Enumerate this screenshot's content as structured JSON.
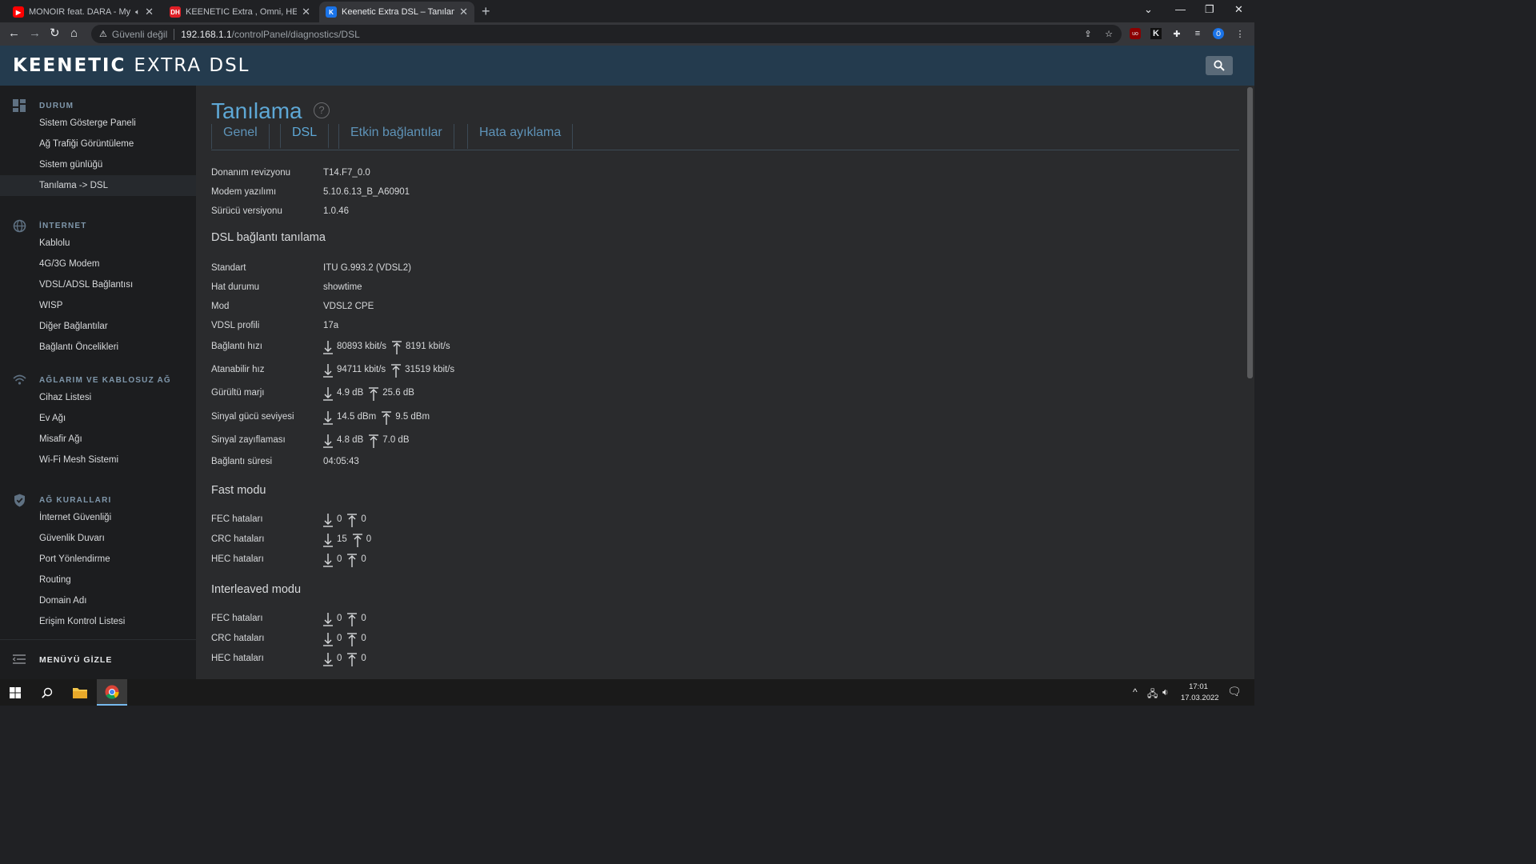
{
  "browser": {
    "tabs": [
      {
        "title": "MONOIR feat. DARA - My Ti",
        "favicon": "youtube-icon",
        "color": "#ff0000"
      },
      {
        "title": "KEENETIC Extra , Omni, HERO ,PE",
        "favicon": "donanimhaber-icon",
        "color": "#e01f26"
      },
      {
        "title": "Keenetic Extra DSL – Tanılama",
        "favicon": "keenetic-icon",
        "color": "#1a73e8"
      }
    ],
    "security_label": "Güvenli değil",
    "url_host": "192.168.1.1",
    "url_path": "/controlPanel/diagnostics/DSL",
    "profile_initial": "ö"
  },
  "header": {
    "brand": "KEENETIC",
    "model": "EXTRA DSL"
  },
  "sidebar": {
    "sections": [
      {
        "title": "DURUM",
        "icon": "dashboard-icon",
        "items": [
          "Sistem Gösterge Paneli",
          "Ağ Trafiği Görüntüleme",
          "Sistem günlüğü",
          "Tanılama -> DSL"
        ]
      },
      {
        "title": "İNTERNET",
        "icon": "globe-icon",
        "items": [
          "Kablolu",
          "4G/3G Modem",
          "VDSL/ADSL Bağlantısı",
          "WISP",
          "Diğer Bağlantılar",
          "Bağlantı Öncelikleri"
        ]
      },
      {
        "title": "AĞLARIM VE KABLOSUZ AĞ",
        "icon": "wifi-icon",
        "items": [
          "Cihaz Listesi",
          "Ev Ağı",
          "Misafir Ağı",
          "Wi-Fi Mesh Sistemi"
        ]
      },
      {
        "title": "AĞ KURALLARI",
        "icon": "shield-icon",
        "items": [
          "İnternet Güvenliği",
          "Güvenlik Duvarı",
          "Port Yönlendirme",
          "Routing",
          "Domain Adı",
          "Erişim Kontrol Listesi"
        ]
      }
    ],
    "active_item": "Tanılama -> DSL",
    "menu_toggle_label": "MENÜYÜ GİZLE"
  },
  "page": {
    "title": "Tanılama",
    "help": "?",
    "tabs": [
      "Genel",
      "DSL",
      "Etkin bağlantılar",
      "Hata ayıklama"
    ],
    "active_tab": "DSL",
    "info": [
      {
        "label": "Donanım revizyonu",
        "value": "T14.F7_0.0"
      },
      {
        "label": "Modem yazılımı",
        "value": "5.10.6.13_B_A60901"
      },
      {
        "label": "Sürücü versiyonu",
        "value": "1.0.46"
      }
    ],
    "dsl_heading": "DSL bağlantı tanılama",
    "dsl_simple": [
      {
        "label": "Standart",
        "value": "ITU G.993.2 (VDSL2)"
      },
      {
        "label": "Hat durumu",
        "value": "showtime"
      },
      {
        "label": "Mod",
        "value": "VDSL2 CPE"
      },
      {
        "label": "VDSL profili",
        "value": "17a"
      }
    ],
    "dsl_updown": [
      {
        "label": "Bağlantı hızı",
        "down": "80893 kbit/s",
        "up": "8191 kbit/s"
      },
      {
        "label": "Atanabilir hız",
        "down": "94711 kbit/s",
        "up": "31519 kbit/s"
      },
      {
        "label": "Gürültü marjı",
        "down": "4.9 dB",
        "up": "25.6 dB"
      },
      {
        "label": "Sinyal gücü seviyesi",
        "down": "14.5 dBm",
        "up": "9.5 dBm"
      },
      {
        "label": "Sinyal zayıflaması",
        "down": "4.8 dB",
        "up": "7.0 dB"
      }
    ],
    "uptime": {
      "label": "Bağlantı süresi",
      "value": "04:05:43"
    },
    "fast_heading": "Fast modu",
    "fast": [
      {
        "label": "FEC hataları",
        "down": "0",
        "up": "0"
      },
      {
        "label": "CRC hataları",
        "down": "15",
        "up": "0"
      },
      {
        "label": "HEC hataları",
        "down": "0",
        "up": "0"
      }
    ],
    "interleaved_heading": "Interleaved modu",
    "interleaved": [
      {
        "label": "FEC hataları",
        "down": "0",
        "up": "0"
      },
      {
        "label": "CRC hataları",
        "down": "0",
        "up": "0"
      },
      {
        "label": "HEC hataları",
        "down": "0",
        "up": "0"
      }
    ]
  },
  "taskbar": {
    "time": "17:01",
    "date": "17.03.2022"
  },
  "colors": {
    "accent": "#5ea8d6",
    "header_bg": "#243b4e",
    "sidebar_bg": "#1c1d1f",
    "main_bg": "#2a2b2d"
  }
}
